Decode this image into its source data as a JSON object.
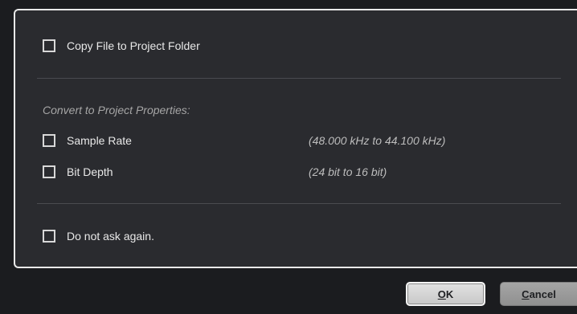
{
  "dialog": {
    "copy_file": {
      "label": "Copy File to Project Folder",
      "checked": false
    },
    "convert_section": {
      "title": "Convert to Project Properties:",
      "items": [
        {
          "label": "Sample Rate",
          "detail": "(48.000 kHz to 44.100 kHz)",
          "checked": false
        },
        {
          "label": "Bit Depth",
          "detail": "(24 bit to 16 bit)",
          "checked": false
        }
      ]
    },
    "do_not_ask": {
      "label": "Do not ask again.",
      "checked": false
    }
  },
  "buttons": {
    "ok": {
      "mnemonic": "O",
      "rest": "K"
    },
    "cancel": {
      "mnemonic": "C",
      "rest": "ancel"
    }
  }
}
